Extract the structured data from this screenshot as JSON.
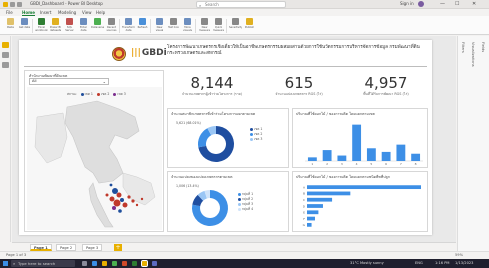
{
  "window": {
    "title": "GBDI_Dashboard - Power BI Desktop",
    "search_placeholder": "Search",
    "sign_in": "Sign in",
    "controls": [
      "—",
      "☐",
      "✕"
    ]
  },
  "ribbon_tabs": [
    "File",
    "Home",
    "Insert",
    "Modeling",
    "View",
    "Help"
  ],
  "ribbon_active_tab": "Home",
  "ribbon_buttons": [
    {
      "label": "Paste",
      "icon": "paste-icon",
      "color": "#e0c16a"
    },
    {
      "label": "Get data",
      "icon": "get-data-icon",
      "color": "#6c8ebf"
    },
    {
      "label": "Excel workbook",
      "icon": "excel-icon",
      "color": "#2e7d32"
    },
    {
      "label": "Power BI datasets",
      "icon": "dataset-icon",
      "color": "#e0b020"
    },
    {
      "label": "SQL Server",
      "icon": "sql-icon",
      "color": "#c0504d"
    },
    {
      "label": "Enter data",
      "icon": "table-icon",
      "color": "#6c8ebf"
    },
    {
      "label": "Dataverse",
      "icon": "dataverse-icon",
      "color": "#4caf50"
    },
    {
      "label": "Recent sources",
      "icon": "recent-icon",
      "color": "#888888"
    },
    {
      "label": "Transform data",
      "icon": "transform-icon",
      "color": "#6c8ebf"
    },
    {
      "label": "Refresh",
      "icon": "refresh-icon",
      "color": "#4a90d9"
    },
    {
      "label": "New visual",
      "icon": "visual-icon",
      "color": "#6c8ebf"
    },
    {
      "label": "Text box",
      "icon": "textbox-icon",
      "color": "#888888"
    },
    {
      "label": "More visuals",
      "icon": "more-visuals-icon",
      "color": "#6c8ebf"
    },
    {
      "label": "New measure",
      "icon": "measure-icon",
      "color": "#888888"
    },
    {
      "label": "Quick measure",
      "icon": "quick-measure-icon",
      "color": "#888888"
    },
    {
      "label": "Sensitivity",
      "icon": "sensitivity-icon",
      "color": "#888888"
    },
    {
      "label": "Publish",
      "icon": "publish-icon",
      "color": "#e0b020"
    }
  ],
  "report": {
    "org_logo_text": "GBDi",
    "title": "โครงการพัฒนาเกษตรกรเชิงเดี่ยวให้เป็นอาชีพเกษตรกรรมผสมผสานด้วยการใช้นวัตกรรมการบริหารจัดการข้อมูล กรมพัฒนาที่ดิน กระทรวงเกษตรและสหกรณ์",
    "slicer_label": "สำนักงานพัฒนาที่ดินเขต",
    "slicer_value": "All",
    "map_legend_title": "สถานะ",
    "map_legend": [
      {
        "label": "เขต 1",
        "color": "#1f4e9c"
      },
      {
        "label": "เขต 2",
        "color": "#c0392b"
      },
      {
        "label": "เขต 3",
        "color": "#7b2d8e"
      }
    ]
  },
  "kpis": [
    {
      "value": "8,144",
      "label": "จำนวนเกษตรกรผู้เข้าร่วมโครงการ (ราย)"
    },
    {
      "value": "615",
      "label": "จำนวนแปลงเกษตรกร RGS (ไร่)"
    },
    {
      "value": "4,957",
      "label": "พื้นที่ได้รับการพัฒนา RGS (ไร่)"
    }
  ],
  "chart_data": [
    {
      "type": "pie",
      "title": "จำนวนสมาชิกเกษตรกรที่เข้าร่วมโครงการแยกตามเขต",
      "categories": [
        "เขต 1",
        "เขต 2",
        "เขต 3"
      ],
      "values": [
        72,
        20,
        8
      ],
      "colors": [
        "#1f4ea0",
        "#3d8fe6",
        "#9ac6f5"
      ],
      "outer_label": "5,621 (68.01%)"
    },
    {
      "type": "bar",
      "title": "ปริมาณที่ใช้ดอกไม้ / ของการผลิต โดยแยกตามเขต",
      "categories": [
        "1",
        "2",
        "3",
        "4",
        "5",
        "6",
        "7",
        "8"
      ],
      "values": [
        2,
        6,
        3,
        20,
        7,
        5,
        9,
        4
      ],
      "ylim": [
        0,
        22
      ],
      "colors": [
        "#3d8fe6"
      ]
    },
    {
      "type": "pie",
      "title": "จำนวนแปลงของแปลงเกษตรกรตามเขต",
      "categories": [
        "กลุ่มที่ 1",
        "กลุ่มที่ 2",
        "กลุ่มที่ 3",
        "กลุ่มที่ 4"
      ],
      "values": [
        78,
        10,
        7,
        5
      ],
      "colors": [
        "#3d8fe6",
        "#1f4ea0",
        "#9ac6f5",
        "#cfe3fa"
      ],
      "outer_label": "1,006 (13.4%)"
    },
    {
      "type": "bar",
      "title": "ปริมาณที่ใช้ดอกไม้ / ของการผลิต โดยแยกตามชนิดพืชที่ปลูก",
      "orientation": "horizontal",
      "categories": [
        "A",
        "B",
        "C",
        "D",
        "E",
        "F",
        "G"
      ],
      "values": [
        100,
        38,
        22,
        14,
        10,
        7,
        4
      ],
      "xlim": [
        0,
        100
      ],
      "colors": [
        "#3d8fe6"
      ]
    }
  ],
  "pages": [
    "Page 1",
    "Page 2",
    "Page 3"
  ],
  "active_page": "Page 1",
  "add_page": "+",
  "status": {
    "left": "Page 1 of 3",
    "right": "59%"
  },
  "right_panes": [
    "Filters",
    "Visualizations",
    "Fields"
  ],
  "taskbar": {
    "search_placeholder": "Type here to search",
    "weather": "31°C  Mostly sunny",
    "clock": "1:16 PM",
    "date": "1/13/2023",
    "lang": "ENG"
  }
}
